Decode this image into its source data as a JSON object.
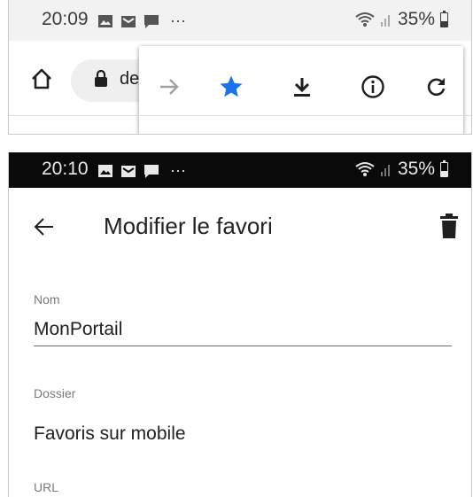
{
  "top": {
    "status_bar": {
      "time": "20:09",
      "notification_icons": [
        "gallery-icon",
        "mail-icon",
        "message-icon"
      ],
      "more": "···",
      "battery": "35%"
    },
    "toolbar": {
      "url_partial": "de",
      "menu_icons": [
        "forward-icon",
        "star-icon",
        "download-icon",
        "info-icon",
        "refresh-icon"
      ],
      "star_color": "#1a73e8"
    }
  },
  "bottom": {
    "status_bar": {
      "time": "20:10",
      "more": "···",
      "battery": "35%"
    },
    "app_bar": {
      "title": "Modifier le favori"
    },
    "form": {
      "name_label": "Nom",
      "name_value": "MonPortail",
      "folder_label": "Dossier",
      "folder_value": "Favoris sur mobile",
      "url_label": "URL"
    }
  }
}
